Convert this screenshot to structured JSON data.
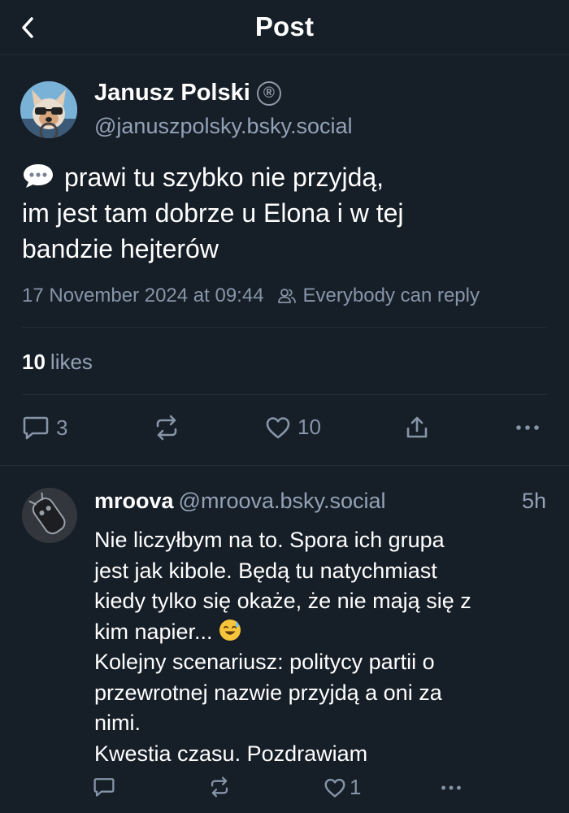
{
  "header": {
    "title": "Post",
    "back_icon": "chevron-left-icon"
  },
  "post": {
    "author_name": "Janusz Polski",
    "badge_icon": "registered-icon",
    "badge_text": "®",
    "author_handle": "@januszpolsky.bsky.social",
    "text_lines": [
      "prawi tu szybko nie przyjdą,",
      "im jest tam dobrze u Elona i w tej",
      "bandzie hejterów"
    ],
    "leading_icon": "speech-bubble-icon",
    "timestamp": "17 November 2024 at 09:44",
    "reply_setting": "Everybody can reply",
    "likes_count": "10",
    "likes_label": "likes",
    "actions": {
      "reply_count": "3",
      "like_count": "10"
    }
  },
  "reply": {
    "author_name": "mroova",
    "author_handle": "@mroova.bsky.social",
    "time": "5h",
    "text_lines": [
      "Nie liczyłbym na to. Spora ich grupa",
      "jest jak kibole. Będą tu natychmiast",
      "kiedy tylko się okaże, że nie mają się z",
      "kim napier...",
      "Kolejny scenariusz: politycy partii o",
      "przewrotnej nazwie przyjdą a oni za",
      "nimi.",
      "Kwestia czasu. Pozdrawiam"
    ],
    "emoji_icon": "sweat-smile-emoji-icon",
    "actions": {
      "like_count": "1"
    }
  },
  "colors": {
    "background": "#161e27",
    "divider": "#232e3e",
    "muted_text": "#93a2b6",
    "icon": "#8795a8"
  }
}
